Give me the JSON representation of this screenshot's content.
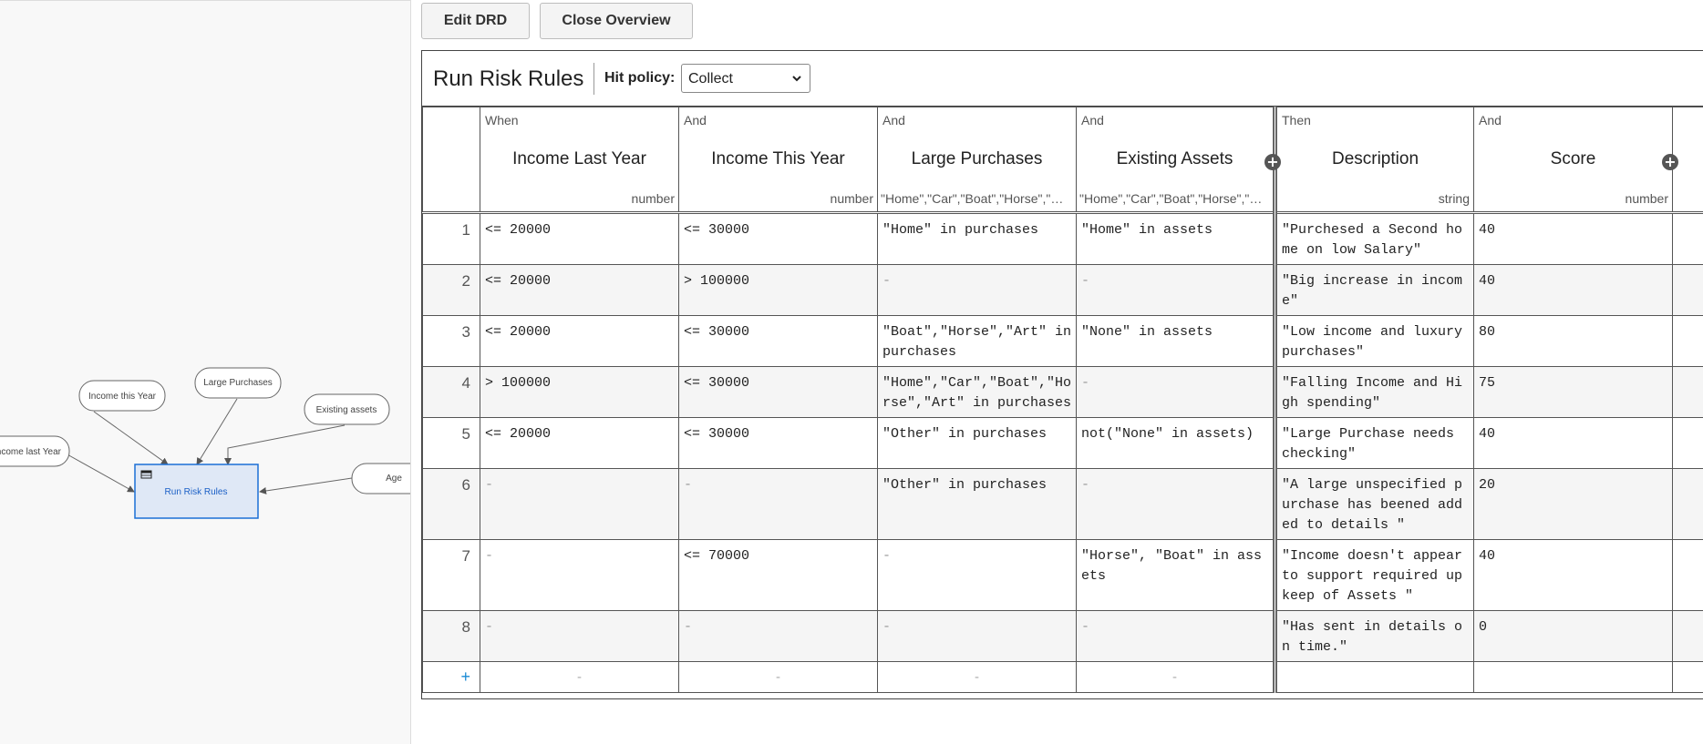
{
  "drd": {
    "nodes": {
      "income_last_year": "Income last Year",
      "income_this_year": "Income this Year",
      "large_purchases": "Large Purchases",
      "existing_assets": "Existing assets",
      "age": "Age",
      "run_risk_rules": "Run Risk Rules"
    }
  },
  "toolbar": {
    "edit_drd": "Edit DRD",
    "close_overview": "Close Overview"
  },
  "decision": {
    "title": "Run Risk Rules",
    "hit_policy_label": "Hit policy:",
    "hit_policy_value": "Collect",
    "columns": [
      {
        "keyword": "When",
        "name": "Income Last Year",
        "type": "number"
      },
      {
        "keyword": "And",
        "name": "Income This Year",
        "type": "number"
      },
      {
        "keyword": "And",
        "name": "Large Purchases",
        "type": "\"Home\",\"Car\",\"Boat\",\"Horse\",\"Art\",\"Other\""
      },
      {
        "keyword": "And",
        "name": "Existing Assets",
        "type": "\"Home\",\"Car\",\"Boat\",\"Horse\",\"Art\",\"None\""
      },
      {
        "keyword": "Then",
        "name": "Description",
        "type": "string"
      },
      {
        "keyword": "And",
        "name": "Score",
        "type": "number"
      }
    ],
    "rows": [
      {
        "n": "1",
        "cells": [
          "<= 20000",
          "<= 30000",
          "\"Home\" in purchases",
          "\"Home\" in assets",
          "\"Purchesed a Second home on low Salary\"",
          "40"
        ]
      },
      {
        "n": "2",
        "cells": [
          "<= 20000",
          "> 100000",
          "-",
          "-",
          "\"Big increase in income\"",
          "40"
        ]
      },
      {
        "n": "3",
        "cells": [
          "<= 20000",
          "<= 30000",
          "\"Boat\",\"Horse\",\"Art\" in purchases",
          "\"None\" in assets",
          "\"Low income and luxury purchases\"",
          "80"
        ]
      },
      {
        "n": "4",
        "cells": [
          "> 100000",
          "<= 30000",
          "\"Home\",\"Car\",\"Boat\",\"Horse\",\"Art\" in purchases",
          "-",
          "\"Falling Income and High spending\"",
          "75"
        ]
      },
      {
        "n": "5",
        "cells": [
          "<= 20000",
          "<= 30000",
          "\"Other\" in purchases",
          "not(\"None\" in assets)",
          "\"Large Purchase needs checking\"",
          "40"
        ]
      },
      {
        "n": "6",
        "cells": [
          "-",
          "-",
          "\"Other\" in purchases",
          "-",
          "\"A large unspecified purchase has beened added to details \"",
          "20"
        ]
      },
      {
        "n": "7",
        "cells": [
          "-",
          "<= 70000",
          "-",
          "\"Horse\", \"Boat\" in assets",
          "\"Income doesn't appear to support required upkeep of Assets \"",
          "40"
        ]
      },
      {
        "n": "8",
        "cells": [
          "-",
          "-",
          "-",
          "-",
          "\"Has sent in details on time.\"",
          "0"
        ]
      }
    ],
    "add_row": {
      "plus": "+",
      "placeholders": [
        "-",
        "-",
        "-",
        "-"
      ]
    },
    "add_column_symbol": "+"
  }
}
